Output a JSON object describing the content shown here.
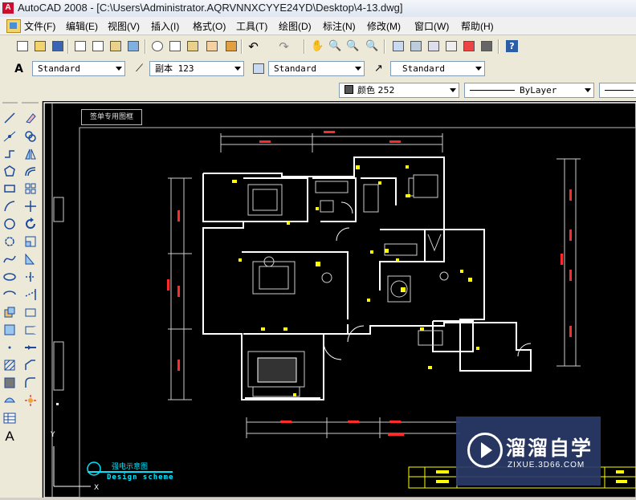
{
  "window": {
    "title": "AutoCAD 2008 - [C:\\Users\\Administrator.AQRVNNXCYYE24YD\\Desktop\\4-13.dwg]"
  },
  "menu": [
    {
      "label": "文件(F)"
    },
    {
      "label": "编辑(E)"
    },
    {
      "label": "视图(V)"
    },
    {
      "label": "插入(I)"
    },
    {
      "label": "格式(O)"
    },
    {
      "label": "工具(T)"
    },
    {
      "label": "绘图(D)"
    },
    {
      "label": "标注(N)"
    },
    {
      "label": "修改(M)"
    },
    {
      "label": "窗口(W)"
    },
    {
      "label": "帮助(H)"
    }
  ],
  "styles_toolbar": {
    "text_style": "Standard",
    "dim_style": "副本 123",
    "table_style": "Standard",
    "multileader_style": "Standard"
  },
  "properties_toolbar": {
    "color": "颜色 252",
    "linetype": "ByLayer"
  },
  "drawing": {
    "title_tag": "签单专用图框",
    "legend_cn": "强电示意图",
    "legend_en": "Design scheme"
  },
  "watermark": {
    "brand": "溜溜自学",
    "url": "ZIXUE.3D66.COM"
  },
  "colors": {
    "canvas": "#000000",
    "walls": "#ffffff",
    "dims": "#ff2a2a",
    "accent": "#ffff00",
    "legend": "#00e5ff"
  }
}
